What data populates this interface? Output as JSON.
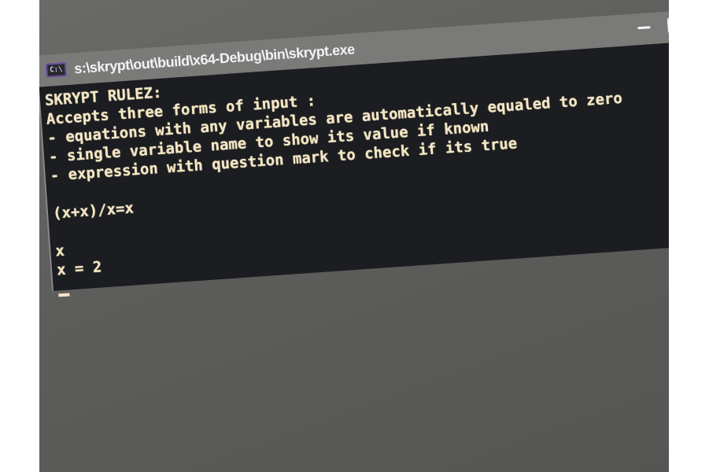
{
  "window": {
    "title": "s:\\skrypt\\out\\build\\x64-Debug\\bin\\skrypt.exe",
    "icon": "C:\\"
  },
  "console": {
    "lines": [
      "SKRYPT RULEZ:",
      "Accepts three forms of input :",
      "- equations with any variables are automatically equaled to zero",
      "- single variable name to show its value if known",
      "- expression with question mark to check if its true",
      "",
      "(x+x)/x=x",
      "",
      "x",
      "x = 2"
    ]
  }
}
